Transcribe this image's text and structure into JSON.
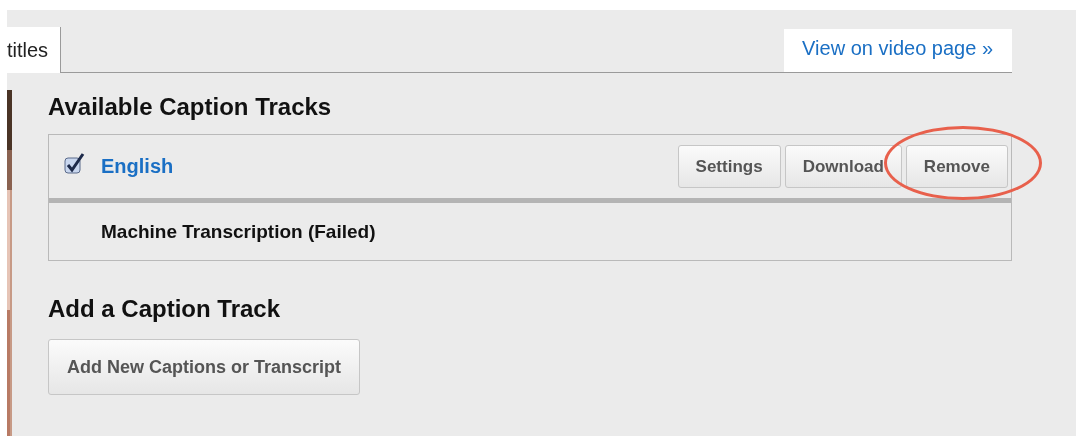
{
  "tabs": [
    {
      "label": "titles",
      "selected": true
    }
  ],
  "view_link": "View on video page »",
  "available_tracks": {
    "title": "Available Caption Tracks",
    "tracks": [
      {
        "kind": "selectable",
        "label": "English",
        "checked": true,
        "buttons": [
          {
            "label": "Settings",
            "circled": false
          },
          {
            "label": "Download",
            "circled": false
          },
          {
            "label": "Remove",
            "circled": true
          }
        ]
      },
      {
        "kind": "status",
        "label": "Machine Transcription (Failed)"
      }
    ]
  },
  "add_track": {
    "title": "Add a Caption Track",
    "button": "Add New Captions or Transcript"
  }
}
